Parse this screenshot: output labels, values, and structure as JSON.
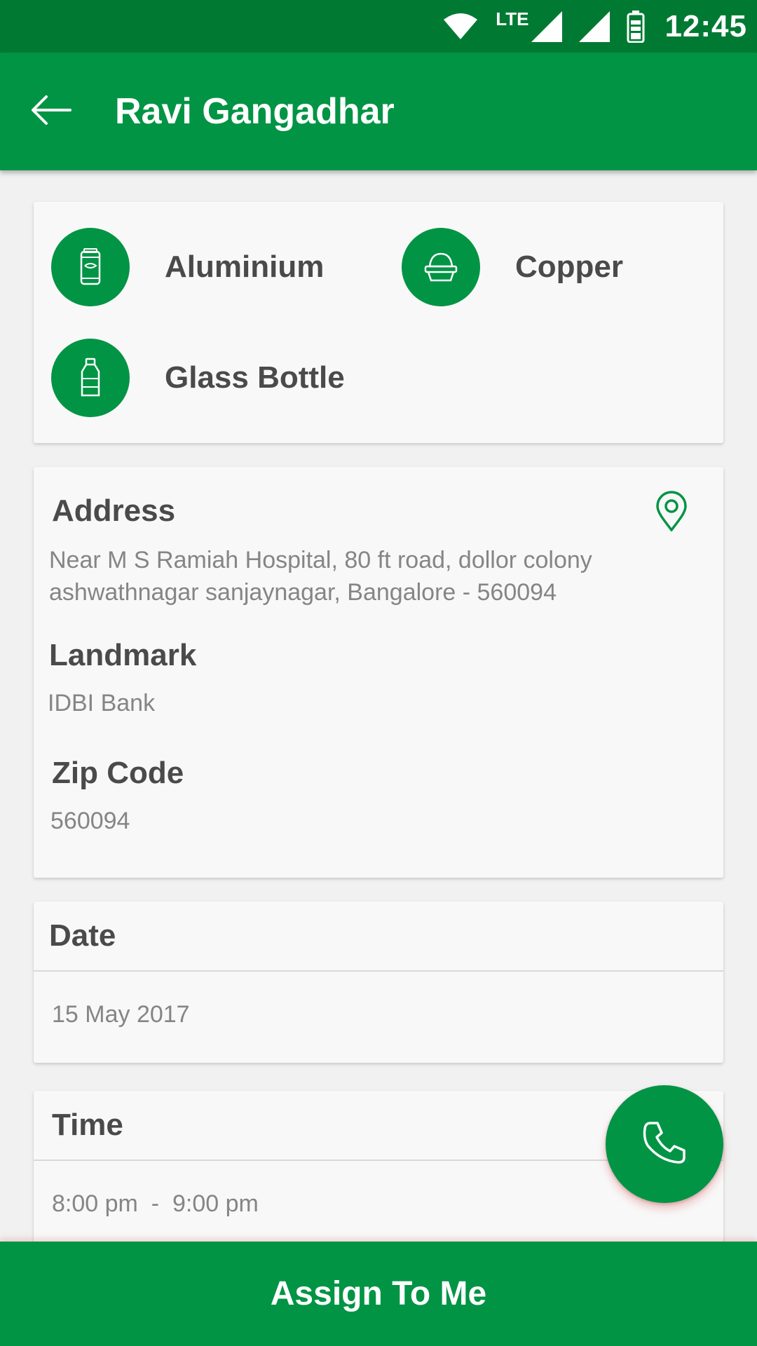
{
  "status_bar": {
    "network_label": "LTE",
    "time": "12:45"
  },
  "app_bar": {
    "title": "Ravi Gangadhar",
    "back_icon": "arrow-back-icon"
  },
  "materials": [
    {
      "label": "Aluminium",
      "icon": "can-icon"
    },
    {
      "label": "Copper",
      "icon": "copper-icon"
    },
    {
      "label": "Glass Bottle",
      "icon": "bottle-icon"
    }
  ],
  "address": {
    "heading": "Address",
    "line1": "Near M S Ramiah Hospital, 80 ft road, dollor colony",
    "line2": "ashwathnagar sanjaynagar, Bangalore - 560094",
    "icon": "location-pin-icon"
  },
  "landmark": {
    "heading": "Landmark",
    "value": "IDBI Bank"
  },
  "zip": {
    "heading": "Zip Code",
    "value": "560094"
  },
  "date": {
    "heading": "Date",
    "value": "15 May 2017"
  },
  "time": {
    "heading": "Time",
    "value": "8:00 pm  -  9:00 pm"
  },
  "fab": {
    "icon": "phone-icon"
  },
  "assign_button": {
    "label": "Assign To Me"
  },
  "colors": {
    "primary": "#009444",
    "status_bar": "#007a33",
    "text_dark": "#4a4a4a",
    "text_muted": "#858585"
  }
}
